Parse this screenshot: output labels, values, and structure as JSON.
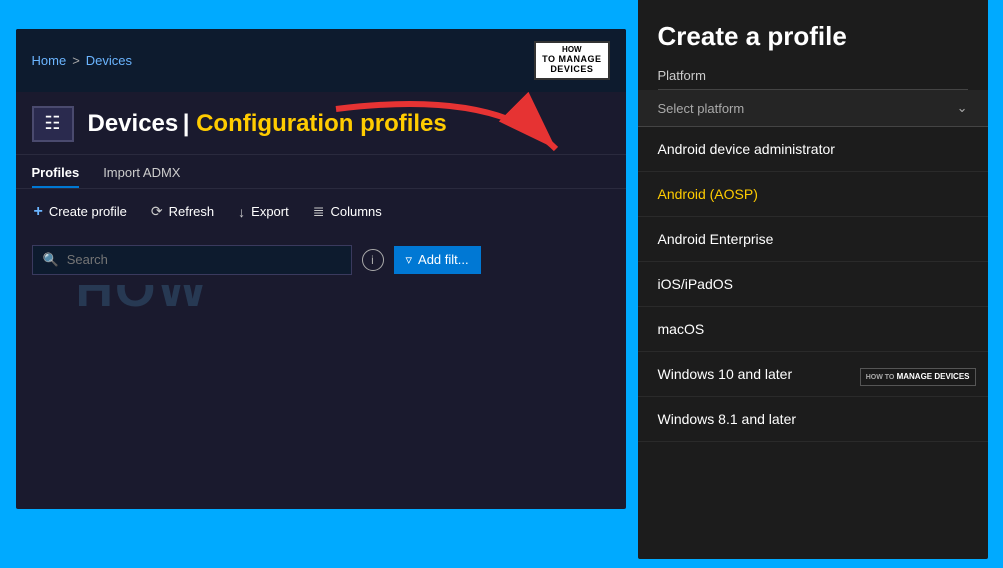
{
  "page": {
    "background_color": "#00aaff"
  },
  "breadcrumb": {
    "home": "Home",
    "separator": ">",
    "current": "Devices"
  },
  "logo_badge": {
    "line1": "HOW",
    "line2": "TO MANAGE",
    "line3": "DEVICES"
  },
  "page_header": {
    "title": "Devices",
    "separator": " | ",
    "subtitle": "Configuration profiles"
  },
  "tabs": [
    {
      "label": "Profiles",
      "active": true
    },
    {
      "label": "Import ADMX",
      "active": false
    }
  ],
  "toolbar": {
    "create_label": "Create profile",
    "refresh_label": "Refresh",
    "export_label": "Export",
    "columns_label": "Columns"
  },
  "search": {
    "placeholder": "Search"
  },
  "filter_button": "Add filt...",
  "right_panel": {
    "title": "Create a profile",
    "platform_label": "Platform",
    "select_placeholder": "Select platform",
    "options": [
      {
        "label": "Android device administrator",
        "yellow": false
      },
      {
        "label": "Android (AOSP)",
        "yellow": true
      },
      {
        "label": "Android Enterprise",
        "yellow": false
      },
      {
        "label": "iOS/iPadOS",
        "yellow": false
      },
      {
        "label": "macOS",
        "yellow": false
      },
      {
        "label": "Windows 10 and later",
        "yellow": false
      },
      {
        "label": "Windows 8.1 and later",
        "yellow": false
      }
    ],
    "bottom_logo": {
      "line1": "HOW TO",
      "line2": "MANAGE",
      "line3": "DEVICES"
    }
  }
}
